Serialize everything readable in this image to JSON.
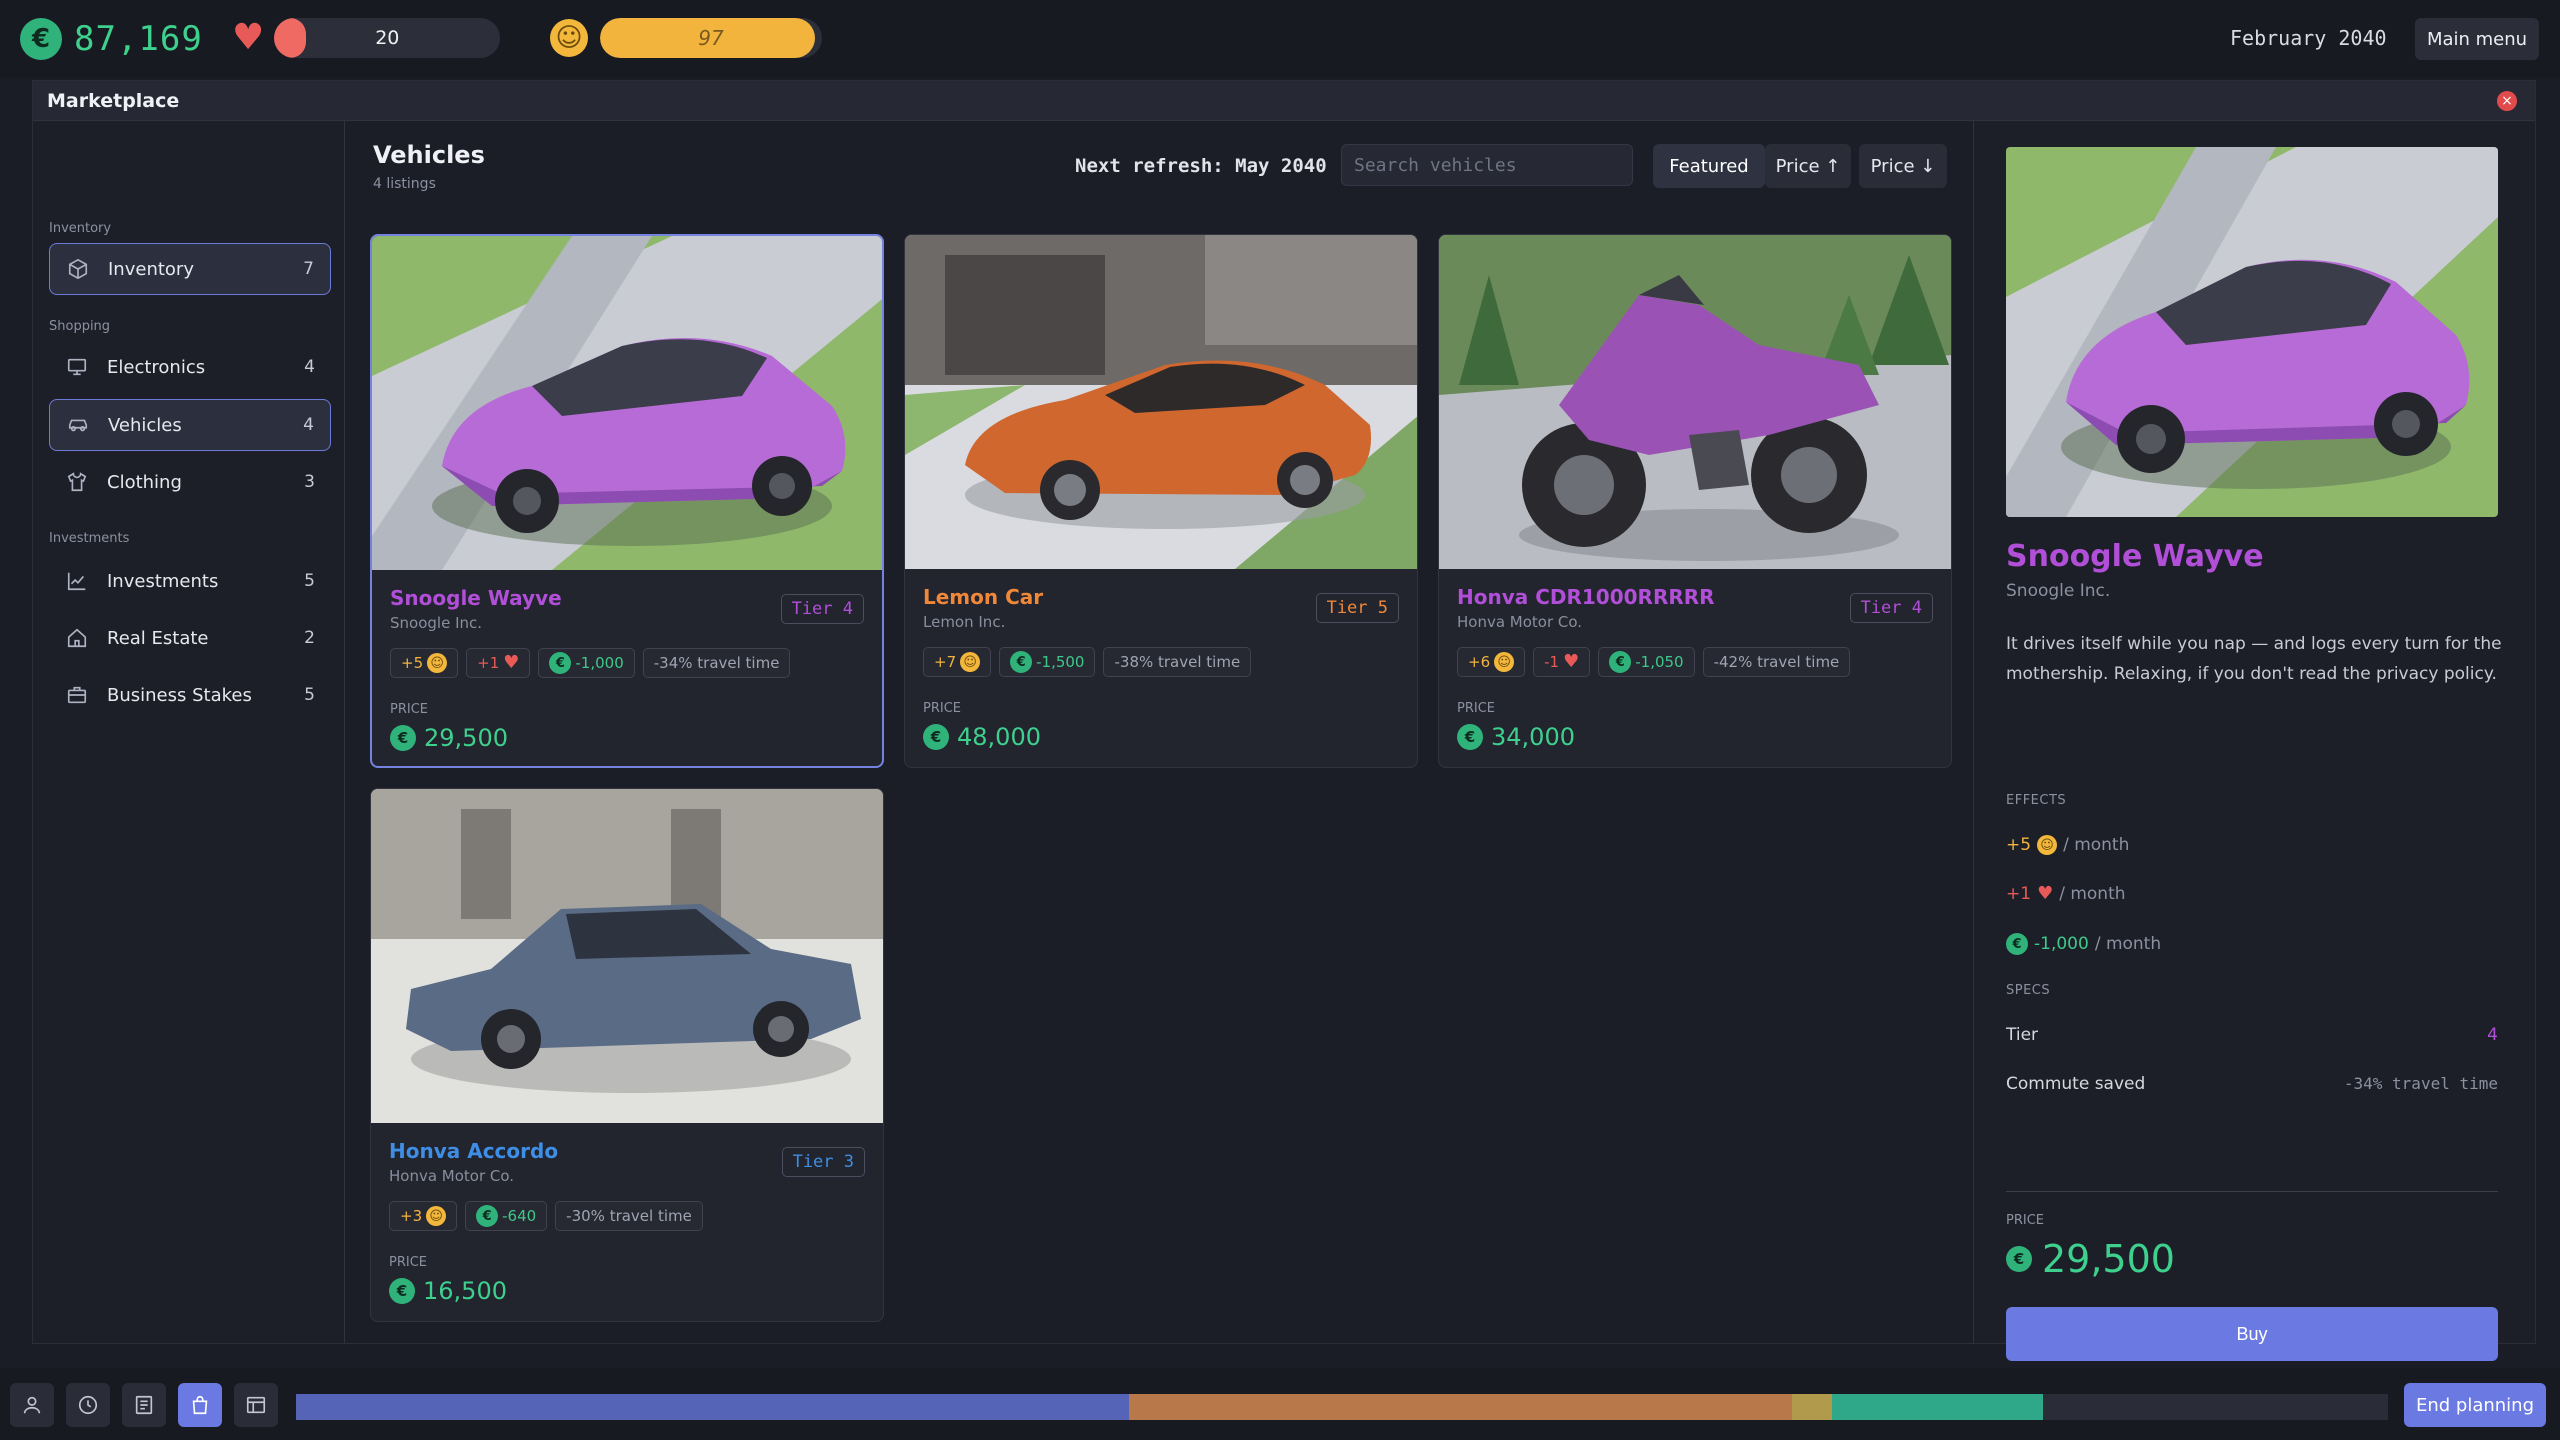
{
  "hud": {
    "money": "87,169",
    "health": {
      "value": "20",
      "fill_fraction": 0.14
    },
    "happiness": {
      "value": "97",
      "fill_fraction": 0.97
    },
    "date": "February 2040",
    "main_menu_label": "Main menu"
  },
  "modal": {
    "title": "Marketplace",
    "close_icon": "close-icon"
  },
  "sidebar": {
    "sections": [
      "Inventory",
      "Shopping",
      "Investments"
    ],
    "items": [
      {
        "label": "Inventory",
        "count": "7",
        "icon": "box-icon"
      },
      {
        "label": "Electronics",
        "count": "4",
        "icon": "monitor-icon"
      },
      {
        "label": "Vehicles",
        "count": "4",
        "icon": "car-icon"
      },
      {
        "label": "Clothing",
        "count": "3",
        "icon": "shirt-icon"
      },
      {
        "label": "Investments",
        "count": "5",
        "icon": "chart-icon"
      },
      {
        "label": "Real Estate",
        "count": "2",
        "icon": "house-icon"
      },
      {
        "label": "Business Stakes",
        "count": "5",
        "icon": "briefcase-icon"
      }
    ]
  },
  "main": {
    "title": "Vehicles",
    "subtitle": "4 listings",
    "refresh": "Next refresh: May 2040",
    "search_placeholder": "Search vehicles",
    "sort": [
      "Featured",
      "Price ↑",
      "Price ↓"
    ]
  },
  "listings": [
    {
      "name": "Snoogle Wayve",
      "maker": "Snoogle Inc.",
      "tier": "Tier 4",
      "color": "#b14fd8",
      "happy": "+5",
      "health": "+1",
      "cost": "-1,000",
      "travel": "-34% travel time",
      "price_label": "PRICE",
      "price": "29,500"
    },
    {
      "name": "Lemon Car",
      "maker": "Lemon Inc.",
      "tier": "Tier 5",
      "color": "#f0883a",
      "happy": "+7",
      "cost": "-1,500",
      "travel": "-38% travel time",
      "price_label": "PRICE",
      "price": "48,000"
    },
    {
      "name": "Honva CDR1000RRRRR",
      "maker": "Honva Motor Co.",
      "tier": "Tier 4",
      "color": "#b14fd8",
      "happy": "+6",
      "health": "-1",
      "cost": "-1,050",
      "travel": "-42% travel time",
      "price_label": "PRICE",
      "price": "34,000"
    },
    {
      "name": "Honva Accordo",
      "maker": "Honva Motor Co.",
      "tier": "Tier 3",
      "color": "#3f8ee6",
      "happy": "+3",
      "cost": "-640",
      "travel": "-30% travel time",
      "price_label": "PRICE",
      "price": "16,500"
    }
  ],
  "detail": {
    "name": "Snoogle Wayve",
    "maker": "Snoogle Inc.",
    "description": "It drives itself while you nap — and logs every turn for the mothership. Relaxing, if you don't read the privacy policy.",
    "effects_label": "EFFECTS",
    "effects": [
      {
        "value": "+5",
        "unit": "/ month",
        "kind": "happiness"
      },
      {
        "value": "+1",
        "unit": "/ month",
        "kind": "health"
      },
      {
        "value": "-1,000",
        "unit": "/ month",
        "kind": "money"
      }
    ],
    "specs_label": "SPECS",
    "specs": [
      {
        "label": "Tier",
        "value": "4"
      },
      {
        "label": "Commute saved",
        "value": "-34% travel time"
      }
    ],
    "price_label": "PRICE",
    "price": "29,500",
    "buy_label": "Buy"
  },
  "bottom": {
    "tools": [
      "person-icon",
      "clock-icon",
      "newspaper-icon",
      "shop-icon",
      "ledger-icon"
    ],
    "timeline_segments": [
      {
        "color": "#5664b8",
        "fraction": 0.398
      },
      {
        "color": "#b9784a",
        "fraction": 0.317
      },
      {
        "color": "#b19a4b",
        "fraction": 0.019
      },
      {
        "color": "#2fa88a",
        "fraction": 0.101
      },
      {
        "color": "#2a2d38",
        "fraction": 0.165
      }
    ],
    "end_label": "End planning"
  }
}
